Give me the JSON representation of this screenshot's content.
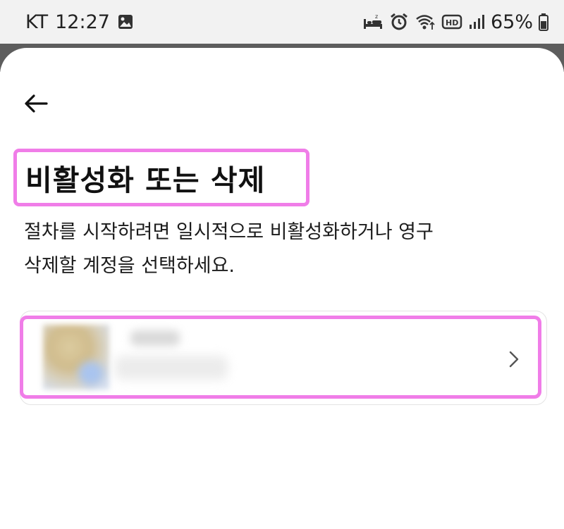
{
  "status_bar": {
    "carrier": "KT",
    "time": "12:27",
    "battery": "65%",
    "left_icons": [
      "image-icon"
    ],
    "right_icons": [
      "bed-icon",
      "alarm-icon",
      "wifi-icon",
      "hd-voice-icon",
      "signal-icon",
      "battery-icon"
    ]
  },
  "nav": {
    "back_icon": "back-arrow-icon"
  },
  "page": {
    "title": "비활성화 또는 삭제",
    "description_line1": "절차를 시작하려면 일시적으로 비활성화하거나 영구",
    "description_line2": "삭제할 계정을 선택하세요."
  },
  "account": {
    "name": "",
    "subtitle": "",
    "chevron_icon": "chevron-right-icon"
  },
  "colors": {
    "highlight": "#f07de8",
    "status_bar_bg": "#f2f2f2",
    "backdrop": "#5d5d5d",
    "text": "#111111"
  }
}
